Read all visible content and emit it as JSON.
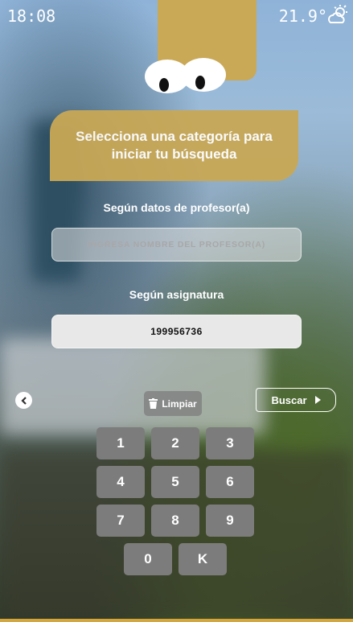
{
  "status_bar": {
    "time": "18:08",
    "temperature": "21.9°",
    "weather_icon": "partly-cloudy-icon"
  },
  "banner": {
    "title": "Selecciona una categoría para iniciar tu búsqueda"
  },
  "teacher_search": {
    "label": "Según datos de profesor(a)",
    "placeholder": "INGRESA NOMBRE DEL PROFESOR(A)",
    "value": ""
  },
  "subject_search": {
    "label": "Según asignatura",
    "value": "199956736"
  },
  "actions": {
    "back_icon": "chevron-left-icon",
    "clear_label": "Limpiar",
    "clear_icon": "trash-icon",
    "search_label": "Buscar",
    "search_icon": "caret-right-icon"
  },
  "keypad": {
    "keys": [
      "1",
      "2",
      "3",
      "4",
      "5",
      "6",
      "7",
      "8",
      "9",
      "0",
      "K"
    ]
  },
  "colors": {
    "accent": "#c9a856",
    "key": "#7c7c7c",
    "bottom_line": "#d4a640"
  }
}
